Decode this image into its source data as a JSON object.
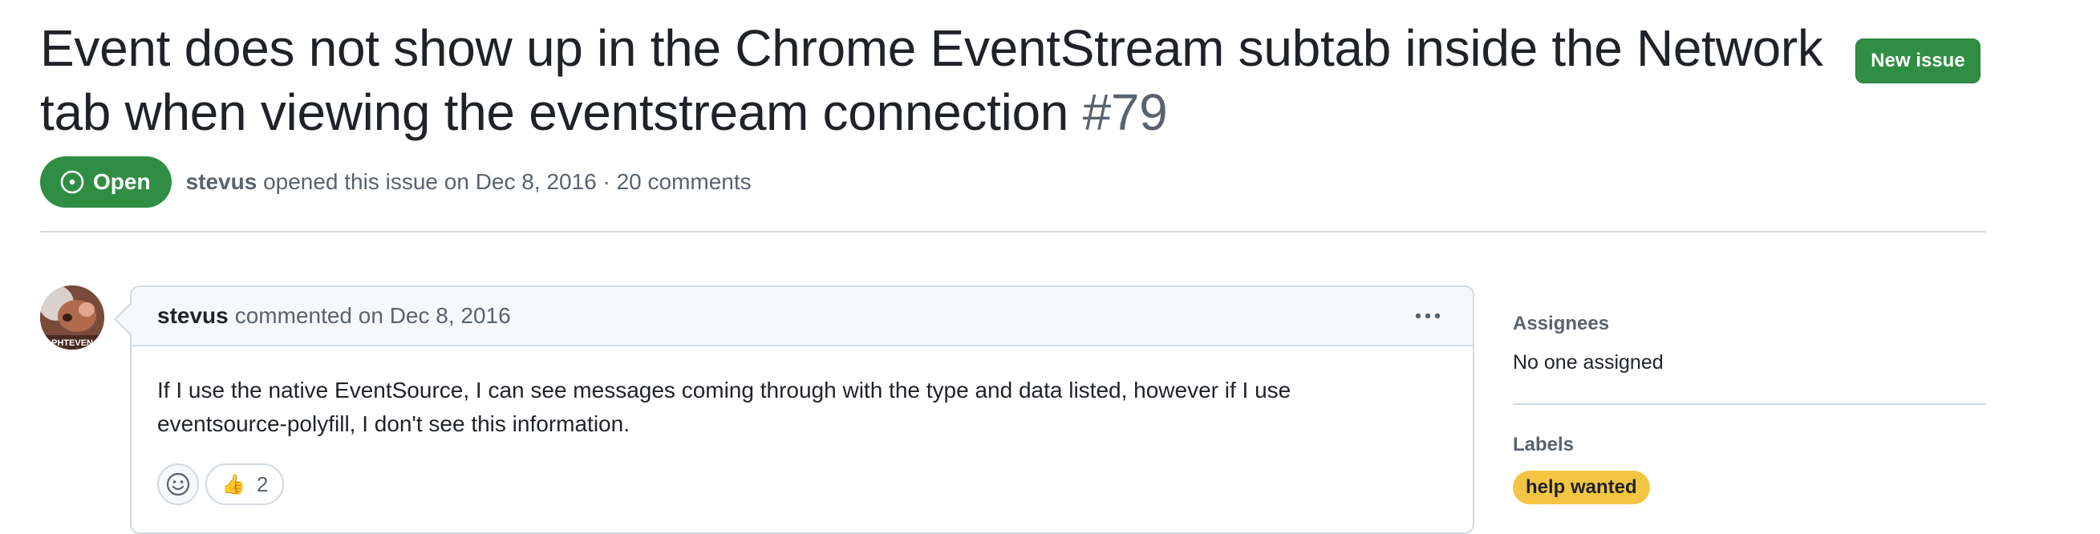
{
  "issue": {
    "title": "Event does not show up in the Chrome EventStream subtab inside the Network tab when viewing the eventstream connection",
    "number": "#79",
    "state": "Open",
    "author": "stevus",
    "opened_text": "opened this issue on Dec 8, 2016 · 20 comments"
  },
  "toolbar": {
    "new_issue_label": "New issue"
  },
  "comment": {
    "author": "stevus",
    "meta": "commented on Dec 8, 2016",
    "body": "If I use the native EventSource, I can see messages coming through with the type and data listed, however if I use eventsource-polyfill, I don't see this information.",
    "reactions": [
      {
        "emoji": "👍",
        "count": "2"
      }
    ]
  },
  "sidebar": {
    "assignees_heading": "Assignees",
    "assignees_value": "No one assigned",
    "labels_heading": "Labels",
    "labels": [
      {
        "name": "help wanted",
        "color": "#f4c542"
      }
    ]
  },
  "avatar_caption": "PHTEVEN",
  "colors": {
    "open_green": "#2f8e43",
    "muted": "#59636e",
    "border": "#d1d9e0"
  }
}
